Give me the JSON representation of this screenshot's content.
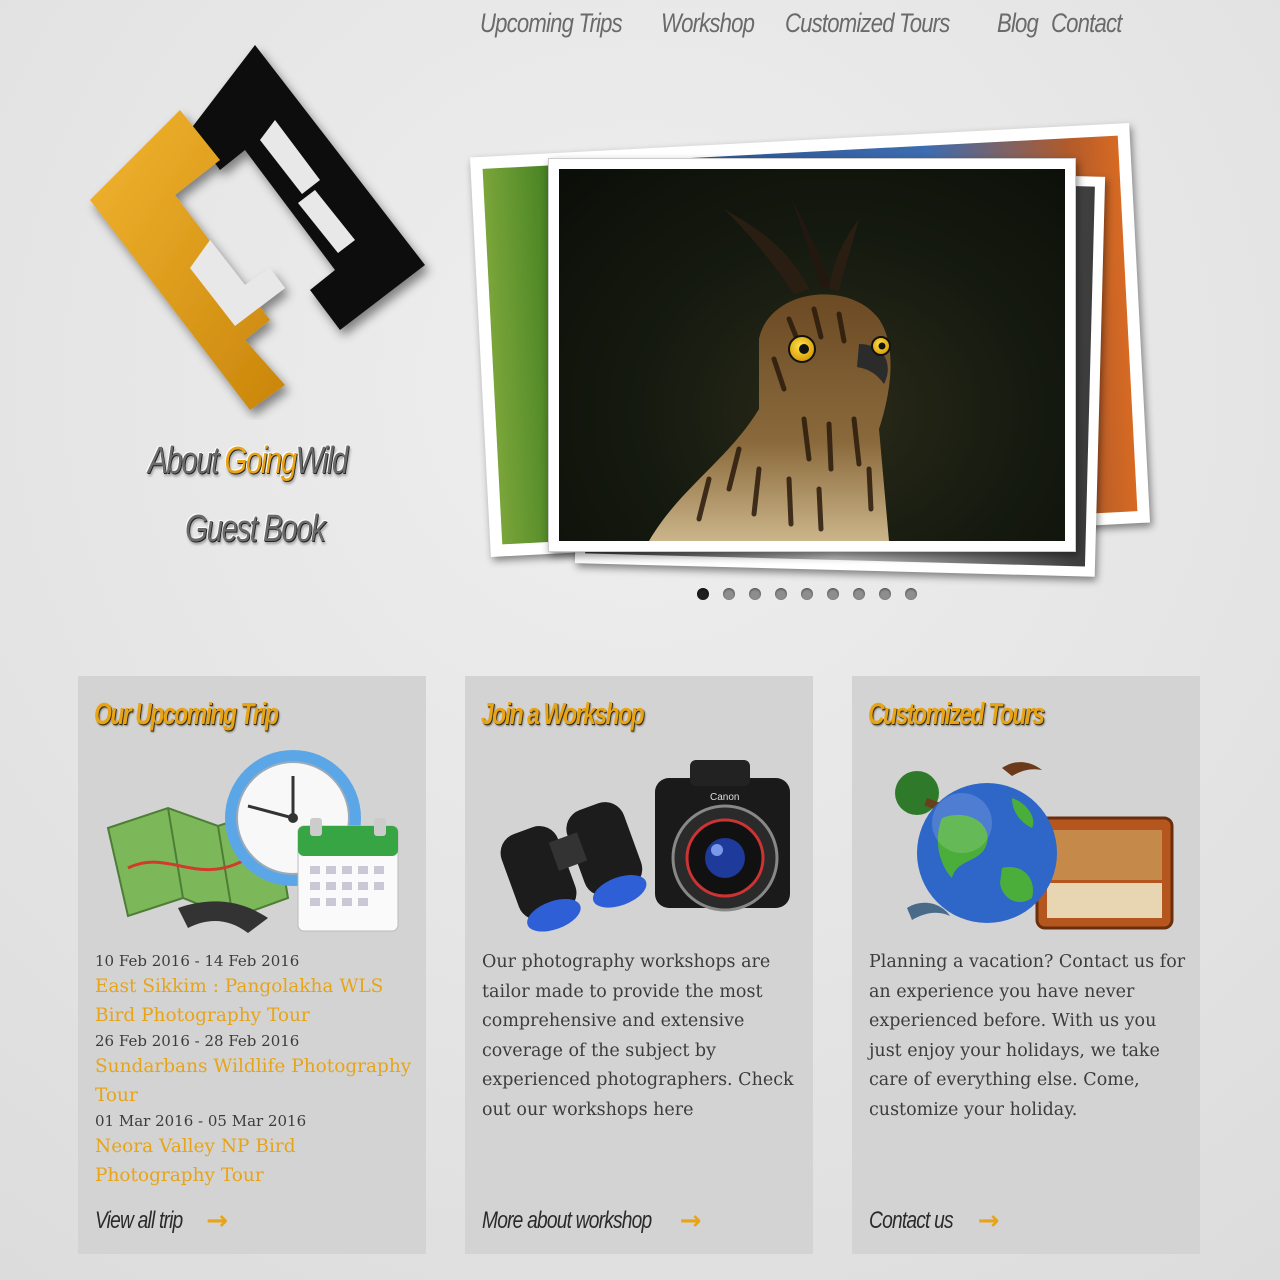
{
  "nav": {
    "items": [
      "Upcoming Trips",
      "Workshop",
      "Customized Tours",
      "Blog",
      "Contact"
    ]
  },
  "sidebar": {
    "about_prefix": "About ",
    "about_accent": "Going",
    "about_suffix": "Wild",
    "guest_book": "Guest Book"
  },
  "slideshow": {
    "slide_count": 9,
    "active_index": 0
  },
  "cards": {
    "trips": {
      "title": "Our Upcoming Trip",
      "items": [
        {
          "date": "10 Feb 2016 - 14 Feb 2016",
          "name": "East Sikkim : Pangolakha WLS Bird Photography Tour"
        },
        {
          "date": "26 Feb 2016 - 28 Feb 2016",
          "name": "Sundarbans Wildlife Photography Tour"
        },
        {
          "date": "01 Mar 2016 - 05 Mar 2016",
          "name": "Neora Valley NP Bird Photography Tour"
        }
      ],
      "more": "View all trip"
    },
    "workshop": {
      "title": "Join a Workshop",
      "text": "Our photography workshops are tailor made to provide the most comprehensive and extensive coverage of the subject by experienced photographers. Check out our workshops here",
      "more": "More about workshop"
    },
    "tours": {
      "title": "Customized Tours",
      "text": "Planning a vacation? Contact us for an experience you have never experienced before. With us you just enjoy your holidays, we take care of everything else. Come, customize your holiday.",
      "more": "Contact us"
    }
  },
  "colors": {
    "accent": "#e8a417",
    "card_bg": "#d3d3d3"
  }
}
